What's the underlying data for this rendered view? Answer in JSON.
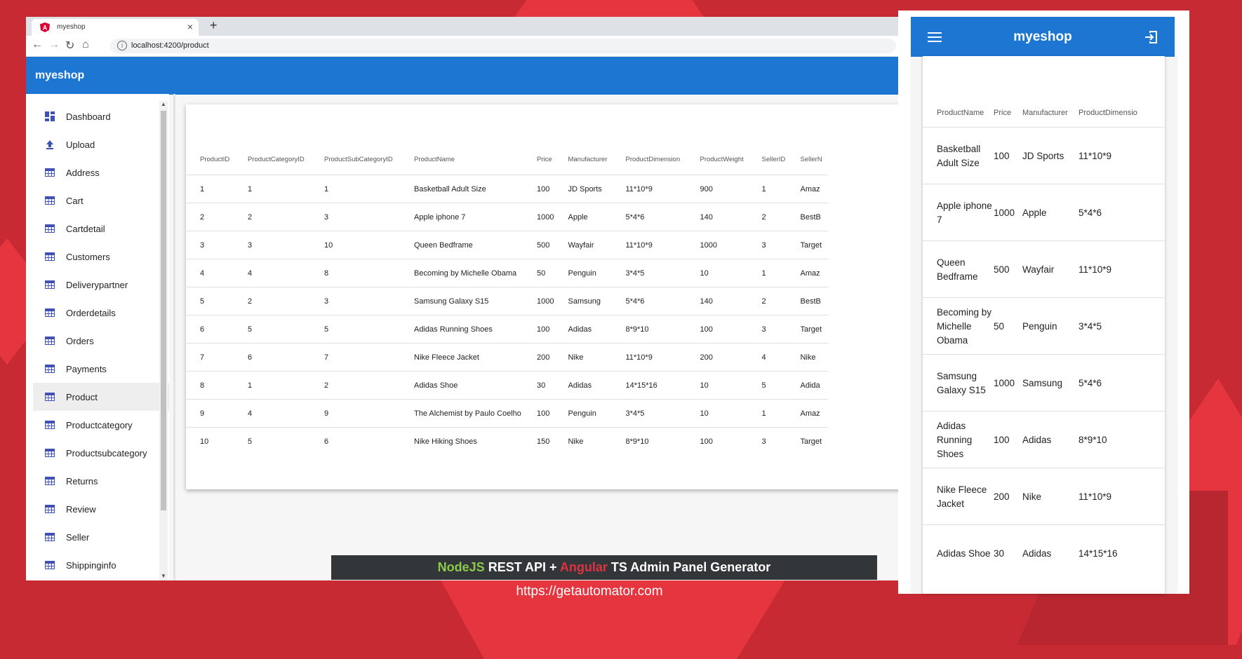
{
  "browser": {
    "tab_title": "myeshop",
    "url": "localhost:4200/product",
    "new_tab_symbol": "+",
    "close_symbol": "×"
  },
  "app": {
    "title": "myeshop"
  },
  "sidebar": {
    "items": [
      {
        "label": "Dashboard",
        "icon": "dashboard-icon"
      },
      {
        "label": "Upload",
        "icon": "upload-icon"
      },
      {
        "label": "Address",
        "icon": "table-icon"
      },
      {
        "label": "Cart",
        "icon": "table-icon"
      },
      {
        "label": "Cartdetail",
        "icon": "table-icon"
      },
      {
        "label": "Customers",
        "icon": "table-icon"
      },
      {
        "label": "Deliverypartner",
        "icon": "table-icon"
      },
      {
        "label": "Orderdetails",
        "icon": "table-icon"
      },
      {
        "label": "Orders",
        "icon": "table-icon"
      },
      {
        "label": "Payments",
        "icon": "table-icon"
      },
      {
        "label": "Product",
        "icon": "table-icon",
        "active": true
      },
      {
        "label": "Productcategory",
        "icon": "table-icon"
      },
      {
        "label": "Productsubcategory",
        "icon": "table-icon"
      },
      {
        "label": "Returns",
        "icon": "table-icon"
      },
      {
        "label": "Review",
        "icon": "table-icon"
      },
      {
        "label": "Seller",
        "icon": "table-icon"
      },
      {
        "label": "Shippinginfo",
        "icon": "table-icon"
      }
    ]
  },
  "table": {
    "columns": [
      "ProductID",
      "ProductCategoryID",
      "ProductSubCategoryID",
      "ProductName",
      "Price",
      "Manufacturer",
      "ProductDimension",
      "ProductWeight",
      "SellerID",
      "SellerN"
    ],
    "rows": [
      [
        "1",
        "1",
        "1",
        "Basketball Adult Size",
        "100",
        "JD Sports",
        "11*10*9",
        "900",
        "1",
        "Amaz"
      ],
      [
        "2",
        "2",
        "3",
        "Apple iphone 7",
        "1000",
        "Apple",
        "5*4*6",
        "140",
        "2",
        "BestB"
      ],
      [
        "3",
        "3",
        "10",
        "Queen Bedframe",
        "500",
        "Wayfair",
        "11*10*9",
        "1000",
        "3",
        "Target"
      ],
      [
        "4",
        "4",
        "8",
        "Becoming by Michelle Obama",
        "50",
        "Penguin",
        "3*4*5",
        "10",
        "1",
        "Amaz"
      ],
      [
        "5",
        "2",
        "3",
        "Samsung Galaxy S15",
        "1000",
        "Samsung",
        "5*4*6",
        "140",
        "2",
        "BestB"
      ],
      [
        "6",
        "5",
        "5",
        "Adidas Running Shoes",
        "100",
        "Adidas",
        "8*9*10",
        "100",
        "3",
        "Target"
      ],
      [
        "7",
        "6",
        "7",
        "Nike Fleece Jacket",
        "200",
        "Nike",
        "11*10*9",
        "200",
        "4",
        "Nike"
      ],
      [
        "8",
        "1",
        "2",
        "Adidas Shoe",
        "30",
        "Adidas",
        "14*15*16",
        "10",
        "5",
        "Adida"
      ],
      [
        "9",
        "4",
        "9",
        "The Alchemist by Paulo Coelho",
        "100",
        "Penguin",
        "3*4*5",
        "10",
        "1",
        "Amaz"
      ],
      [
        "10",
        "5",
        "6",
        "Nike Hiking Shoes",
        "150",
        "Nike",
        "8*9*10",
        "100",
        "3",
        "Target"
      ]
    ]
  },
  "mobile": {
    "title": "myeshop",
    "columns": [
      "ProductName",
      "Price",
      "Manufacturer",
      "ProductDimensio"
    ],
    "rows": [
      {
        "name": "Basketball Adult Size",
        "price": "100",
        "manufacturer": "JD Sports",
        "dimension": "11*10*9"
      },
      {
        "name": "Apple iphone 7",
        "price": "1000",
        "manufacturer": "Apple",
        "dimension": "5*4*6"
      },
      {
        "name": "Queen Bedframe",
        "price": "500",
        "manufacturer": "Wayfair",
        "dimension": "11*10*9"
      },
      {
        "name": "Becoming by Michelle Obama",
        "price": "50",
        "manufacturer": "Penguin",
        "dimension": "3*4*5"
      },
      {
        "name": "Samsung Galaxy S15",
        "price": "1000",
        "manufacturer": "Samsung",
        "dimension": "5*4*6"
      },
      {
        "name": "Adidas Running Shoes",
        "price": "100",
        "manufacturer": "Adidas",
        "dimension": "8*9*10"
      },
      {
        "name": "Nike Fleece Jacket",
        "price": "200",
        "manufacturer": "Nike",
        "dimension": "11*10*9"
      },
      {
        "name": "Adidas Shoe",
        "price": "30",
        "manufacturer": "Adidas",
        "dimension": "14*15*16"
      }
    ]
  },
  "banner": {
    "part1": "NodeJS",
    "part2": " REST API + ",
    "part3": "Angular",
    "part4": " TS Admin Panel Generator"
  },
  "site_link": "https://getautomator.com",
  "colors": {
    "brand_blue": "#1c76d2",
    "icon_blue": "#3f51b5",
    "background_red": "#c82a33",
    "nodejs_green": "#8cc84b",
    "angular_red": "#dd3341"
  }
}
